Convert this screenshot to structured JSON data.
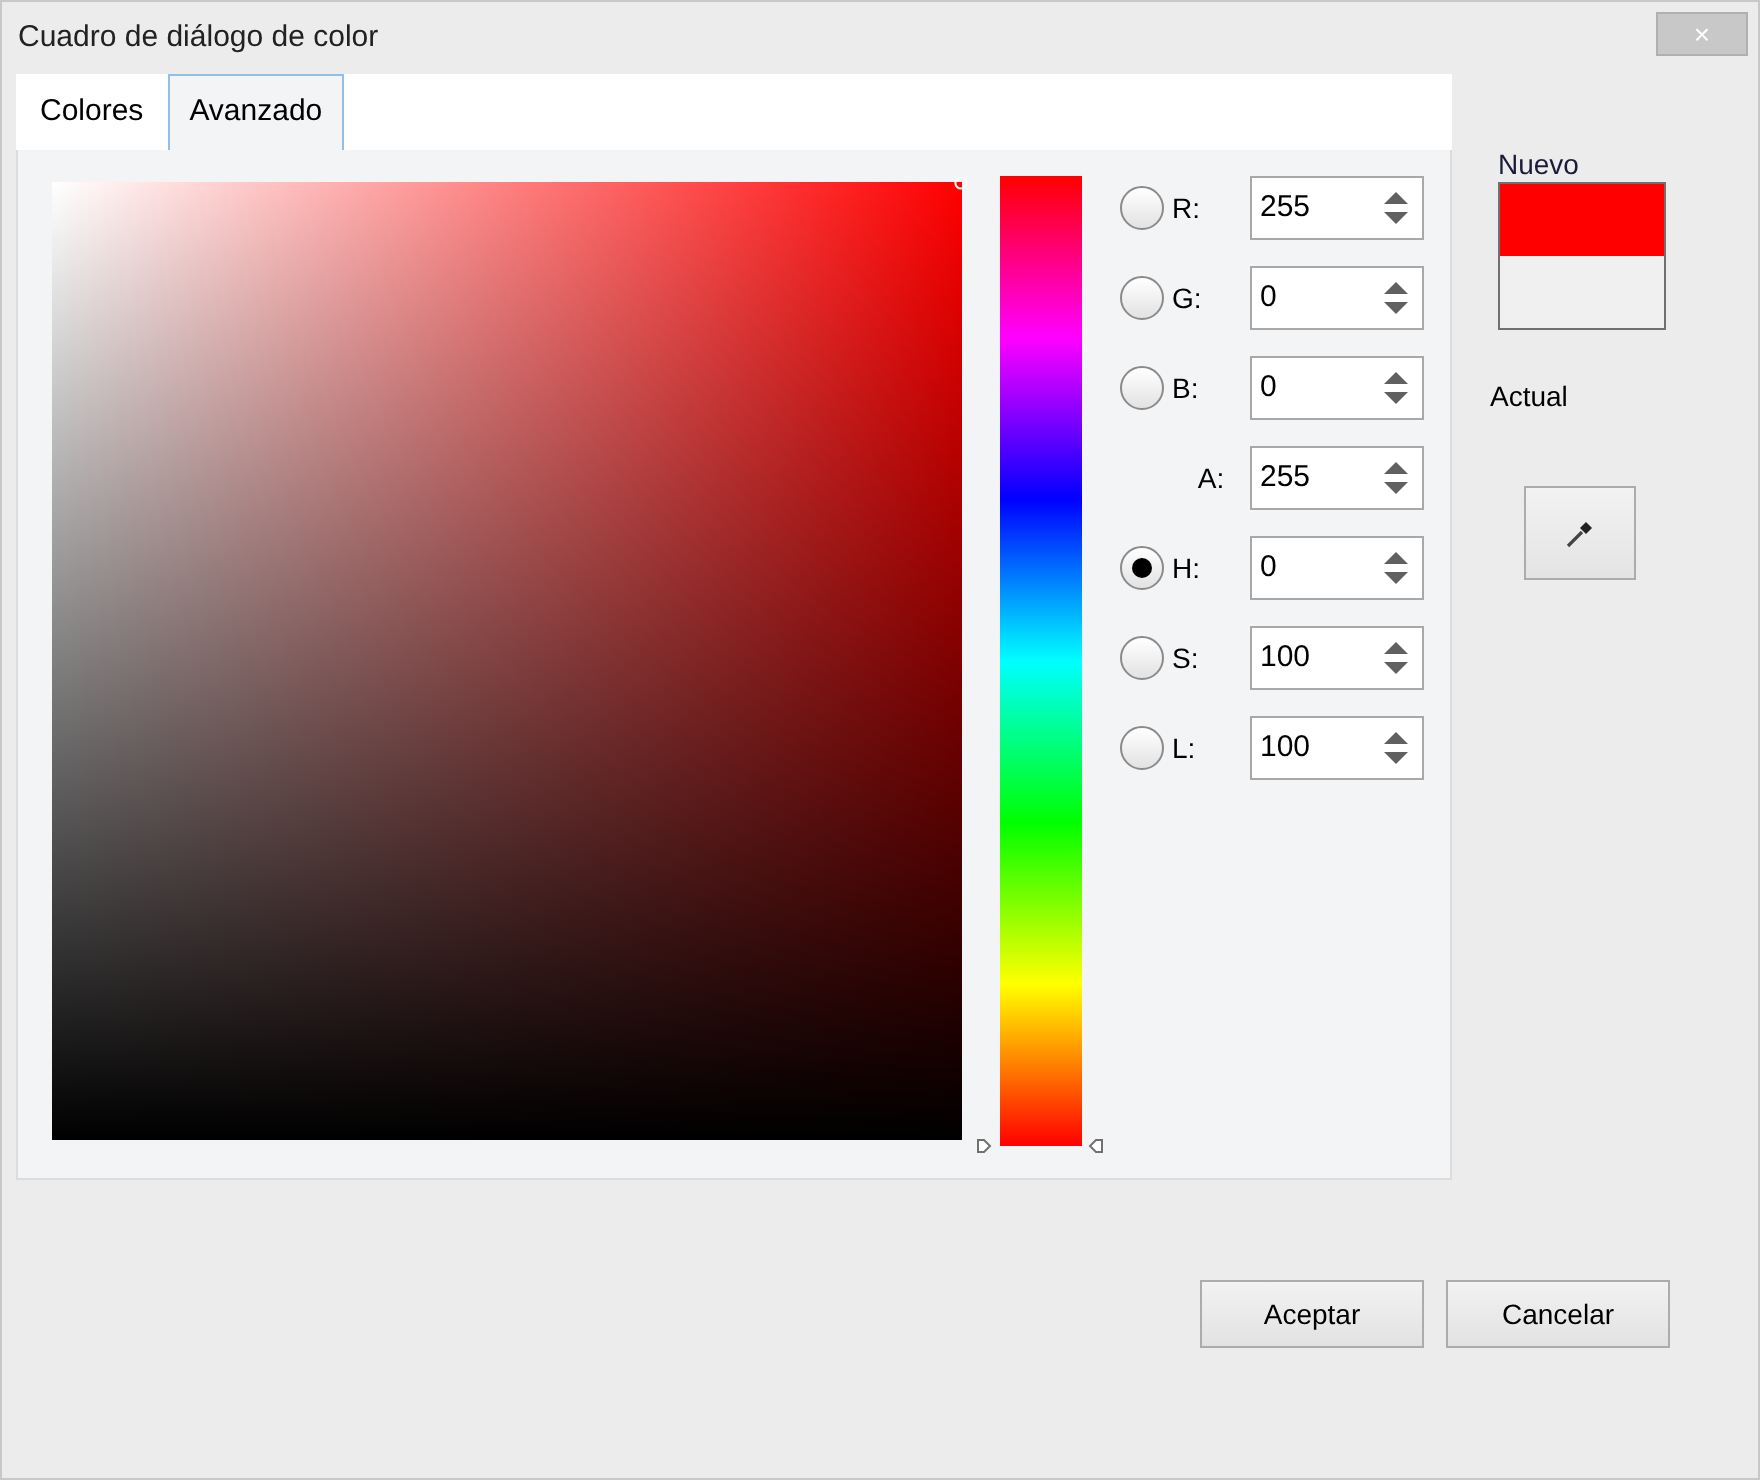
{
  "window": {
    "title": "Cuadro de diálogo de color",
    "close": "×"
  },
  "tabs": [
    {
      "label": "Colores",
      "selected": false
    },
    {
      "label": "Avanzado",
      "selected": true
    }
  ],
  "hue_slider": {
    "level": 0
  },
  "fields": [
    {
      "kind": "radio",
      "label": "R:",
      "value": "255",
      "selected": false
    },
    {
      "kind": "radio",
      "label": "G:",
      "value": "0",
      "selected": false
    },
    {
      "kind": "radio",
      "label": "B:",
      "value": "0",
      "selected": false
    },
    {
      "kind": "plain",
      "label": "A:",
      "value": "255"
    },
    {
      "kind": "radio",
      "label": "H:",
      "value": "0",
      "selected": true
    },
    {
      "kind": "radio",
      "label": "S:",
      "value": "100",
      "selected": false
    },
    {
      "kind": "radio",
      "label": "L:",
      "value": "100",
      "selected": false
    }
  ],
  "preview": {
    "new_label": "Nuevo",
    "swatches": [
      {
        "color": "#ff0000"
      },
      {
        "color": "#f0f0f0"
      }
    ],
    "current_label": "Actual"
  },
  "buttons": [
    "Aceptar",
    "Cancelar"
  ]
}
